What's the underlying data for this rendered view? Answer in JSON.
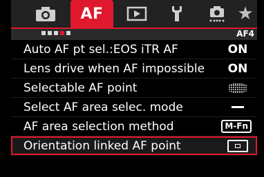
{
  "tabs": {
    "camera_icon": "camera-icon",
    "af_label": "AF",
    "play_icon": "play-icon",
    "wrench_icon": "wrench-icon",
    "custom_icon": "custom-function-icon",
    "star_label": "★"
  },
  "sub": {
    "page_code": "AF4",
    "pages": 5,
    "current_page": 4
  },
  "menu": {
    "items": [
      {
        "label": "Auto AF pt sel.:EOS iTR AF",
        "value": "ON"
      },
      {
        "label": "Lens drive when AF impossible",
        "value": "ON"
      },
      {
        "label": "Selectable AF point",
        "value_icon": "af-point-grid-icon"
      },
      {
        "label": "Select AF area selec. mode",
        "value_icon": "dash-icon"
      },
      {
        "label": "AF area selection method",
        "value": "M-Fn"
      },
      {
        "label": "Orientation linked AF point",
        "value_icon": "af-frame-icon"
      }
    ]
  },
  "colors": {
    "accent": "#e0182d",
    "background": "#000000",
    "tab_bar": "#222222"
  }
}
